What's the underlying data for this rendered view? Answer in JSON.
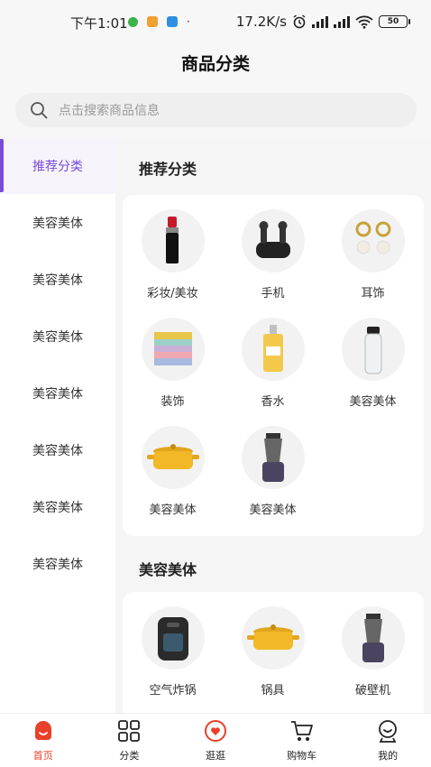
{
  "status_bar": {
    "time": "下午1:01",
    "net_speed": "17.2K/s",
    "battery": "50"
  },
  "header": {
    "title": "商品分类"
  },
  "search": {
    "placeholder": "点击搜索商品信息"
  },
  "sidebar": {
    "items": [
      {
        "label": "推荐分类",
        "active": true
      },
      {
        "label": "美容美体"
      },
      {
        "label": "美容美体"
      },
      {
        "label": "美容美体"
      },
      {
        "label": "美容美体"
      },
      {
        "label": "美容美体"
      },
      {
        "label": "美容美体"
      },
      {
        "label": "美容美体"
      }
    ]
  },
  "sections": [
    {
      "title": "推荐分类",
      "items": [
        {
          "label": "彩妆/美妆",
          "icon": "lipstick-icon"
        },
        {
          "label": "手机",
          "icon": "earbuds-icon"
        },
        {
          "label": "耳饰",
          "icon": "earrings-icon"
        },
        {
          "label": "装饰",
          "icon": "towels-icon"
        },
        {
          "label": "香水",
          "icon": "perfume-icon"
        },
        {
          "label": "美容美体",
          "icon": "bottle-icon"
        },
        {
          "label": "美容美体",
          "icon": "pot-icon"
        },
        {
          "label": "美容美体",
          "icon": "blender-icon"
        }
      ]
    },
    {
      "title": "美容美体",
      "items": [
        {
          "label": "空气炸锅",
          "icon": "air-fryer-icon"
        },
        {
          "label": "锅具",
          "icon": "pot-icon"
        },
        {
          "label": "破壁机",
          "icon": "blender-icon"
        }
      ]
    }
  ],
  "tabbar": {
    "tabs": [
      {
        "label": "首页",
        "icon": "home-icon",
        "active": true
      },
      {
        "label": "分类",
        "icon": "category-icon"
      },
      {
        "label": "逛逛",
        "icon": "browse-icon"
      },
      {
        "label": "购物车",
        "icon": "cart-icon"
      },
      {
        "label": "我的",
        "icon": "profile-icon"
      }
    ]
  },
  "colors": {
    "accent": "#7a4ad8",
    "tab_active": "#e8402a"
  }
}
